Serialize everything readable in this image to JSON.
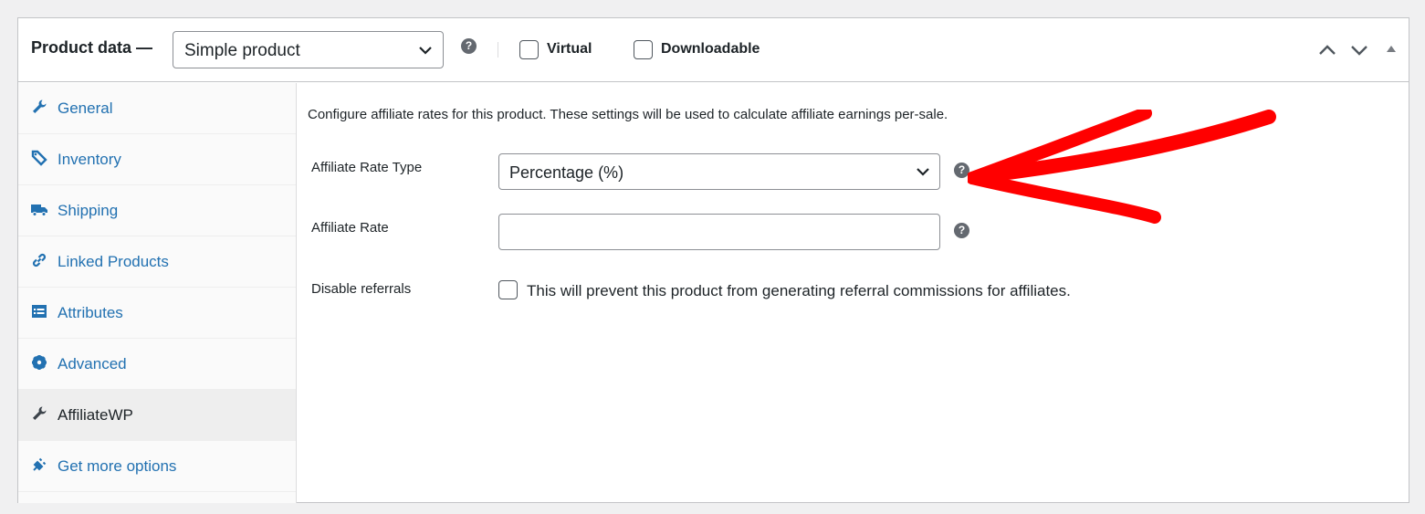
{
  "header": {
    "title": "Product data —",
    "product_type": "Simple product",
    "virtual_label": "Virtual",
    "downloadable_label": "Downloadable",
    "virtual_checked": false,
    "downloadable_checked": false
  },
  "sidebar": {
    "items": [
      {
        "label": "General",
        "icon": "wrench-icon",
        "active": false
      },
      {
        "label": "Inventory",
        "icon": "tag-icon",
        "active": false
      },
      {
        "label": "Shipping",
        "icon": "truck-icon",
        "active": false
      },
      {
        "label": "Linked Products",
        "icon": "link-icon",
        "active": false
      },
      {
        "label": "Attributes",
        "icon": "list-icon",
        "active": false
      },
      {
        "label": "Advanced",
        "icon": "gear-icon",
        "active": false
      },
      {
        "label": "AffiliateWP",
        "icon": "wrench-icon",
        "active": true
      },
      {
        "label": "Get more options",
        "icon": "plugin-icon",
        "active": false
      }
    ]
  },
  "main": {
    "description": "Configure affiliate rates for this product. These settings will be used to calculate affiliate earnings per-sale.",
    "rate_type_label": "Affiliate Rate Type",
    "rate_type_value": "Percentage (%)",
    "rate_label": "Affiliate Rate",
    "rate_value": "",
    "disable_label": "Disable referrals",
    "disable_description": "This will prevent this product from generating referral commissions for affiliates.",
    "disable_checked": false
  },
  "colors": {
    "link": "#2271b1",
    "annotation_arrow": "#ff0000",
    "border": "#c3c4c7"
  }
}
